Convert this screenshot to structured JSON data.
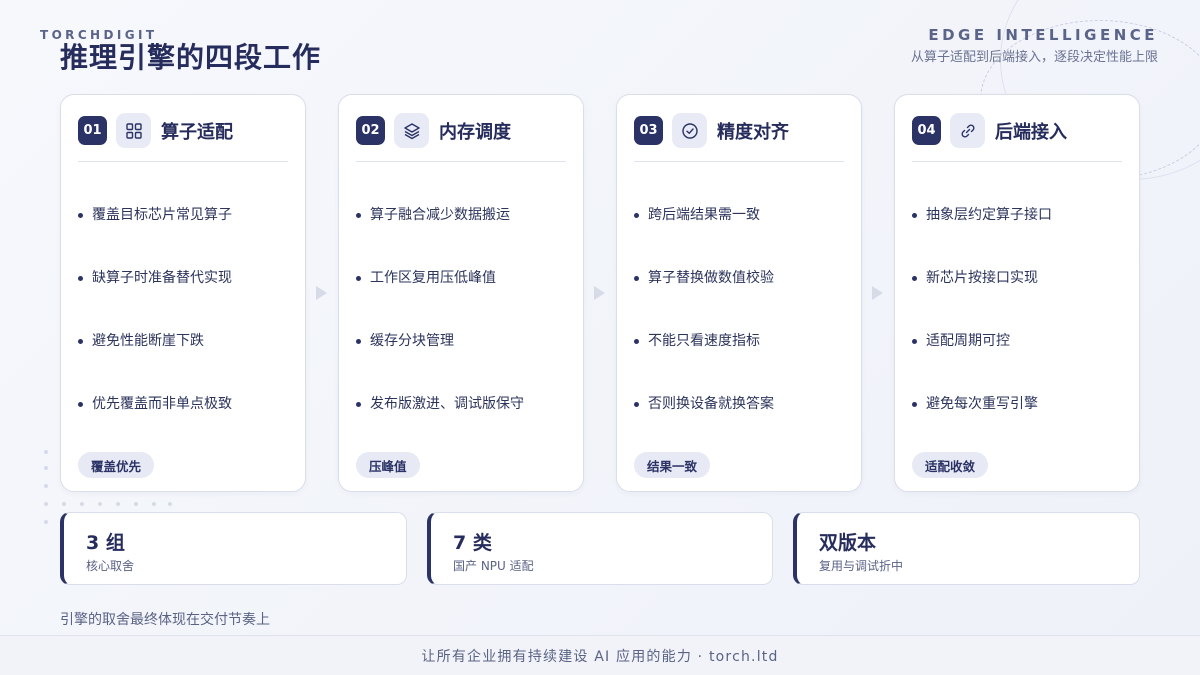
{
  "brand": "TORCHDIGIT",
  "title": "推理引擎的四段工作",
  "top_right": {
    "en": "EDGE INTELLIGENCE",
    "sub": "从算子适配到后端接入，逐段决定性能上限"
  },
  "cards": [
    {
      "num": "01",
      "icon": "grid-icon",
      "title": "算子适配",
      "bullets": [
        "覆盖目标芯片常见算子",
        "缺算子时准备替代实现",
        "避免性能断崖下跌",
        "优先覆盖而非单点极致"
      ],
      "tag": "覆盖优先"
    },
    {
      "num": "02",
      "icon": "layers-icon",
      "title": "内存调度",
      "bullets": [
        "算子融合减少数据搬运",
        "工作区复用压低峰值",
        "缓存分块管理",
        "发布版激进、调试版保守"
      ],
      "tag": "压峰值"
    },
    {
      "num": "03",
      "icon": "check-circle-icon",
      "title": "精度对齐",
      "bullets": [
        "跨后端结果需一致",
        "算子替换做数值校验",
        "不能只看速度指标",
        "否则换设备就换答案"
      ],
      "tag": "结果一致"
    },
    {
      "num": "04",
      "icon": "link-icon",
      "title": "后端接入",
      "bullets": [
        "抽象层约定算子接口",
        "新芯片按接口实现",
        "适配周期可控",
        "避免每次重写引擎"
      ],
      "tag": "适配收敛"
    }
  ],
  "stats": [
    {
      "big": "3 组",
      "small": "核心取舍"
    },
    {
      "big": "7 类",
      "small": "国产 NPU 适配"
    },
    {
      "big": "双版本",
      "small": "复用与调试折中"
    }
  ],
  "note": "引擎的取舍最终体现在交付节奏上",
  "footer": "让所有企业拥有持续建设 AI 应用的能力 · torch.ltd",
  "colors": {
    "accent": "#2b3366",
    "tag_bg": "#e7e9f4",
    "icon_bg": "#e8ebf5"
  }
}
